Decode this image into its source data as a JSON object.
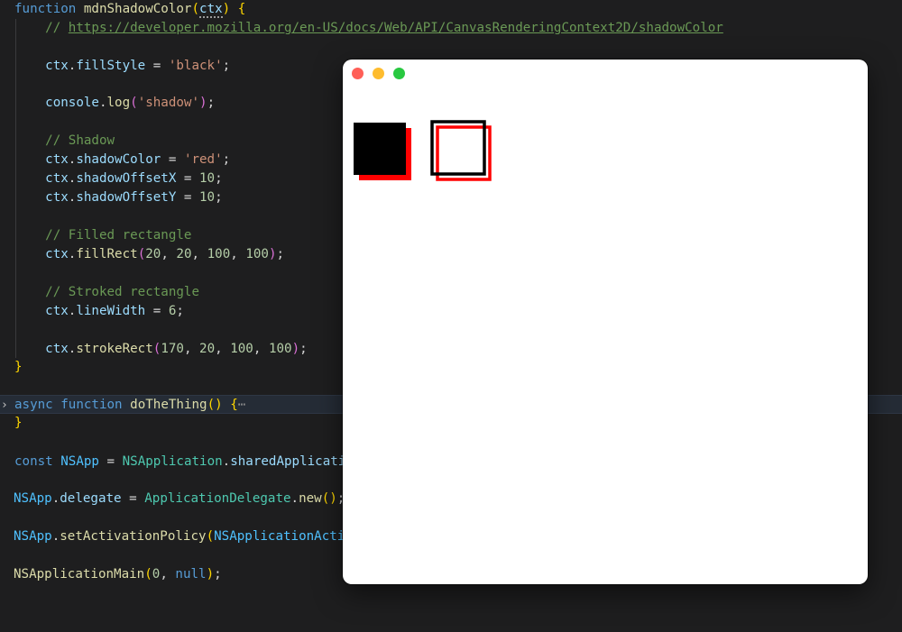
{
  "editor": {
    "line1": {
      "kw": "function",
      "name": "mdnShadowColor",
      "open": "(",
      "param": "ctx",
      "close": ")",
      "brace": "{"
    },
    "line2": {
      "slashes": "// ",
      "url": "https://developer.mozilla.org/en-US/docs/Web/API/CanvasRenderingContext2D/shadowColor"
    },
    "line3": {
      "obj": "ctx",
      "prop": "fillStyle",
      "op": " = ",
      "str": "'black'",
      "end": ";"
    },
    "line4": {
      "obj": "console",
      "fn": "log",
      "open": "(",
      "str": "'shadow'",
      "close": ")",
      "end": ";"
    },
    "line5": {
      "comment": "// Shadow"
    },
    "line6": {
      "obj": "ctx",
      "prop": "shadowColor",
      "op": " = ",
      "str": "'red'",
      "end": ";"
    },
    "line7": {
      "obj": "ctx",
      "prop": "shadowOffsetX",
      "op": " = ",
      "num": "10",
      "end": ";"
    },
    "line8": {
      "obj": "ctx",
      "prop": "shadowOffsetY",
      "op": " = ",
      "num": "10",
      "end": ";"
    },
    "line9": {
      "comment": "// Filled rectangle"
    },
    "line10": {
      "obj": "ctx",
      "fn": "fillRect",
      "open": "(",
      "a": "20",
      "b": "20",
      "c": "100",
      "d": "100",
      "close": ")",
      "end": ";"
    },
    "line11": {
      "comment": "// Stroked rectangle"
    },
    "line12": {
      "obj": "ctx",
      "prop": "lineWidth",
      "op": " = ",
      "num": "6",
      "end": ";"
    },
    "line13": {
      "obj": "ctx",
      "fn": "strokeRect",
      "open": "(",
      "a": "170",
      "b": "20",
      "c": "100",
      "d": "100",
      "close": ")",
      "end": ";"
    },
    "line14": {
      "brace": "}"
    },
    "line15": {
      "kw1": "async",
      "kw2": "function",
      "name": "doTheThing",
      "parens": "()",
      "brace": "{",
      "ellipsis": "⋯",
      "fold": "›"
    },
    "line16": {
      "brace": "}"
    },
    "line17": {
      "kw": "const",
      "var": "NSApp",
      "op": " = ",
      "cls": "NSApplication",
      "prop": "sharedApplicatio"
    },
    "line18": {
      "var": "NSApp",
      "prop": "delegate",
      "op": " = ",
      "cls": "ApplicationDelegate",
      "fn": "new",
      "parens": "()",
      "end": ";"
    },
    "line19": {
      "var": "NSApp",
      "fn": "setActivationPolicy",
      "open": "(",
      "arg": "NSApplicationActiv"
    },
    "line20": {
      "fn": "NSApplicationMain",
      "open": "(",
      "num": "0",
      "kw": "null",
      "close": ")",
      "end": ";"
    }
  },
  "colors": {
    "window_bg": "#ffffff",
    "fill_color": "#000000",
    "shadow_color": "#ff0000",
    "close": "#ff5f57",
    "minimize": "#febc2e",
    "maximize": "#28c840"
  }
}
